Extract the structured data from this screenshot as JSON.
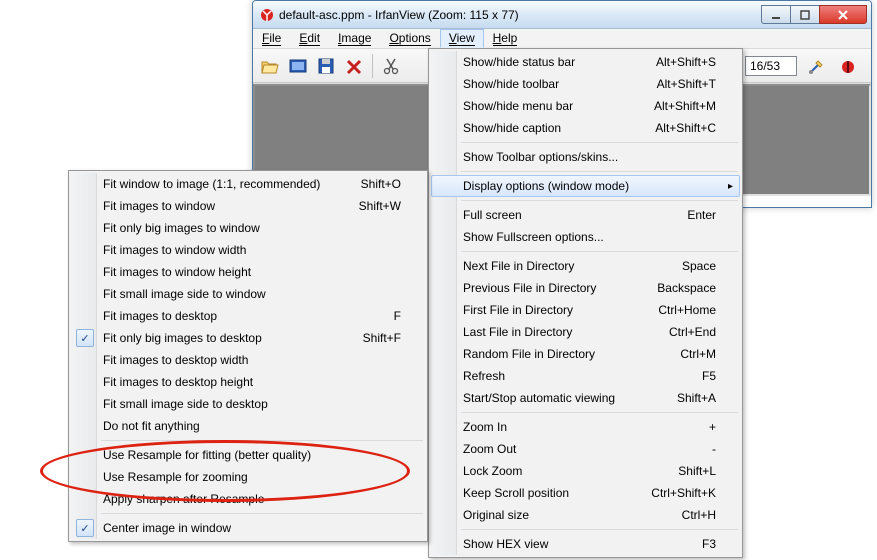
{
  "window": {
    "title": "default-asc.ppm - IrfanView (Zoom: 115 x 77)"
  },
  "menubar": {
    "file": "File",
    "edit": "Edit",
    "image": "Image",
    "options": "Options",
    "view": "View",
    "help": "Help"
  },
  "toolbar": {
    "page_value": "16/53"
  },
  "view_menu": {
    "items": [
      {
        "label": "Show/hide status bar",
        "accel": "Alt+Shift+S"
      },
      {
        "label": "Show/hide toolbar",
        "accel": "Alt+Shift+T"
      },
      {
        "label": "Show/hide menu bar",
        "accel": "Alt+Shift+M"
      },
      {
        "label": "Show/hide caption",
        "accel": "Alt+Shift+C"
      },
      {
        "sep": true
      },
      {
        "label": "Show Toolbar options/skins..."
      },
      {
        "sep": true
      },
      {
        "label": "Display options (window mode)",
        "submenu": true,
        "hover": true
      },
      {
        "sep": true
      },
      {
        "label": "Full screen",
        "accel": "Enter"
      },
      {
        "label": "Show Fullscreen options..."
      },
      {
        "sep": true
      },
      {
        "label": "Next File in Directory",
        "accel": "Space"
      },
      {
        "label": "Previous File in Directory",
        "accel": "Backspace"
      },
      {
        "label": "First File in Directory",
        "accel": "Ctrl+Home"
      },
      {
        "label": "Last File in Directory",
        "accel": "Ctrl+End"
      },
      {
        "label": "Random File in Directory",
        "accel": "Ctrl+M"
      },
      {
        "label": "Refresh",
        "accel": "F5"
      },
      {
        "label": "Start/Stop automatic viewing",
        "accel": "Shift+A"
      },
      {
        "sep": true
      },
      {
        "label": "Zoom In",
        "accel": "+"
      },
      {
        "label": "Zoom Out",
        "accel": "-"
      },
      {
        "label": "Lock Zoom",
        "accel": "Shift+L"
      },
      {
        "label": "Keep Scroll position",
        "accel": "Ctrl+Shift+K"
      },
      {
        "label": "Original size",
        "accel": "Ctrl+H"
      },
      {
        "sep": true
      },
      {
        "label": "Show HEX view",
        "accel": "F3"
      }
    ]
  },
  "display_menu": {
    "items": [
      {
        "label": "Fit window to image (1:1, recommended)",
        "accel": "Shift+O"
      },
      {
        "label": "Fit images to window",
        "accel": "Shift+W"
      },
      {
        "label": "Fit only big images to window"
      },
      {
        "label": "Fit images to window width"
      },
      {
        "label": "Fit images to window height"
      },
      {
        "label": "Fit small image side to window"
      },
      {
        "label": "Fit images to desktop",
        "accel": "F"
      },
      {
        "label": "Fit only big images to desktop",
        "accel": "Shift+F",
        "checked": true
      },
      {
        "label": "Fit images to desktop width"
      },
      {
        "label": "Fit images to desktop height"
      },
      {
        "label": "Fit small image side to desktop"
      },
      {
        "label": "Do not fit anything"
      },
      {
        "sep": true
      },
      {
        "label": "Use Resample for fitting (better quality)"
      },
      {
        "label": "Use Resample for zooming"
      },
      {
        "label": "Apply sharpen after Resample"
      },
      {
        "sep": true
      },
      {
        "label": "Center image in window",
        "checked": true
      }
    ]
  }
}
